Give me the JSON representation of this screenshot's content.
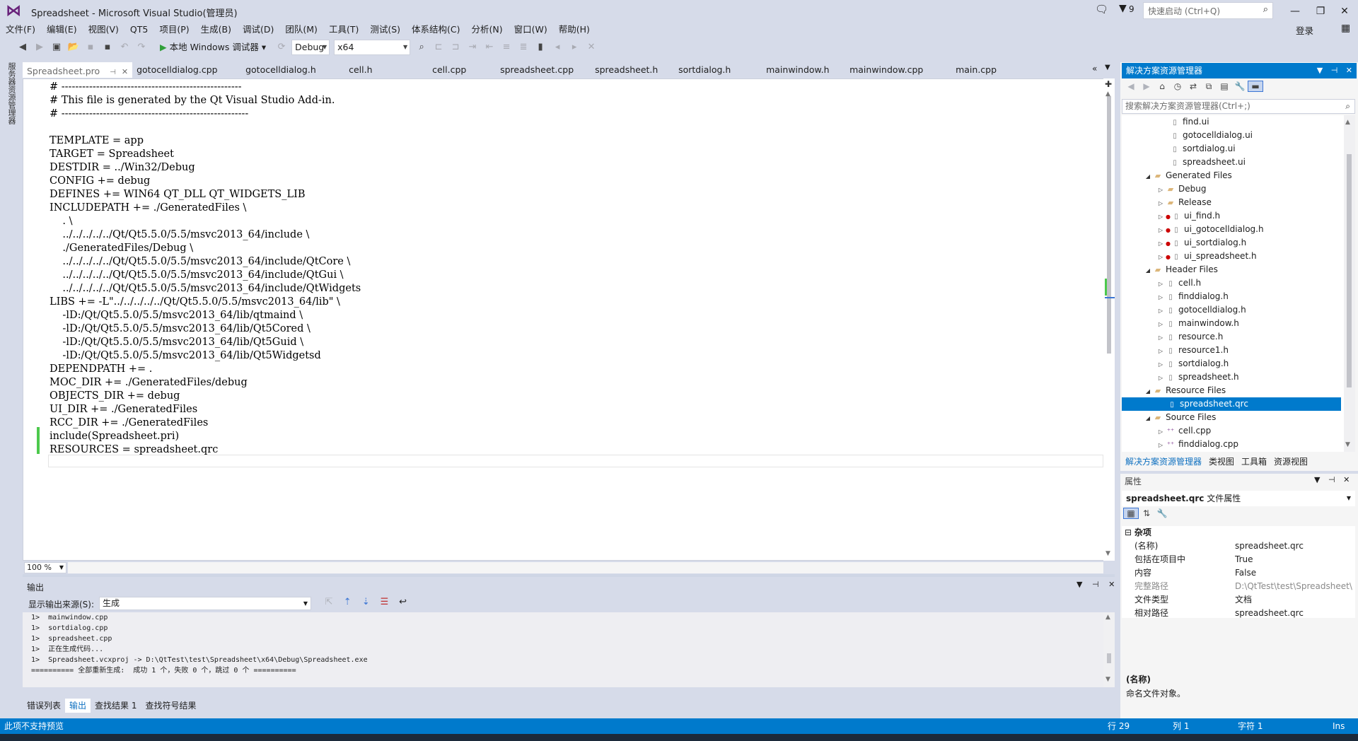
{
  "window": {
    "title": "Spreadsheet - Microsoft Visual Studio(管理员)",
    "notification_count": "9",
    "quick_launch_placeholder": "快速启动 (Ctrl+Q)",
    "login": "登录"
  },
  "menu": [
    "文件(F)",
    "编辑(E)",
    "视图(V)",
    "QT5",
    "项目(P)",
    "生成(B)",
    "调试(D)",
    "团队(M)",
    "工具(T)",
    "测试(S)",
    "体系结构(C)",
    "分析(N)",
    "窗口(W)",
    "帮助(H)"
  ],
  "toolbar": {
    "start_label": "本地 Windows 调试器",
    "config": "Debug",
    "platform": "x64"
  },
  "left_strip_label": "服务器资源管理器",
  "tabs": {
    "active": "Spreadsheet.pro",
    "others": [
      "gotocelldialog.cpp",
      "gotocelldialog.h",
      "cell.h",
      "cell.cpp",
      "spreadsheet.cpp",
      "spreadsheet.h",
      "sortdialog.h",
      "mainwindow.h",
      "mainwindow.cpp",
      "main.cpp"
    ]
  },
  "editor": {
    "code": "# ----------------------------------------------------\n# This file is generated by the Qt Visual Studio Add-in.\n# ------------------------------------------------------\n\nTEMPLATE = app\nTARGET = Spreadsheet\nDESTDIR = ../Win32/Debug\nCONFIG += debug\nDEFINES += WIN64 QT_DLL QT_WIDGETS_LIB\nINCLUDEPATH += ./GeneratedFiles \\\n    . \\\n    ../../../../../Qt/Qt5.5.0/5.5/msvc2013_64/include \\\n    ./GeneratedFiles/Debug \\\n    ../../../../../Qt/Qt5.5.0/5.5/msvc2013_64/include/QtCore \\\n    ../../../../../Qt/Qt5.5.0/5.5/msvc2013_64/include/QtGui \\\n    ../../../../../Qt/Qt5.5.0/5.5/msvc2013_64/include/QtWidgets\nLIBS += -L\"../../../../../Qt/Qt5.5.0/5.5/msvc2013_64/lib\" \\\n    -lD:/Qt/Qt5.5.0/5.5/msvc2013_64/lib/qtmaind \\\n    -lD:/Qt/Qt5.5.0/5.5/msvc2013_64/lib/Qt5Cored \\\n    -lD:/Qt/Qt5.5.0/5.5/msvc2013_64/lib/Qt5Guid \\\n    -lD:/Qt/Qt5.5.0/5.5/msvc2013_64/lib/Qt5Widgetsd\nDEPENDPATH += .\nMOC_DIR += ./GeneratedFiles/debug\nOBJECTS_DIR += debug\nUI_DIR += ./GeneratedFiles\nRCC_DIR += ./GeneratedFiles\ninclude(Spreadsheet.pri)\nRESOURCES = spreadsheet.qrc",
    "zoom": "100 %"
  },
  "output": {
    "title": "输出",
    "source_label": "显示输出来源(S):",
    "source_value": "生成",
    "text": "1>  mainwindow.cpp\n1>  sortdialog.cpp\n1>  spreadsheet.cpp\n1>  正在生成代码...\n1>  Spreadsheet.vcxproj -> D:\\QtTest\\test\\Spreadsheet\\x64\\Debug\\Spreadsheet.exe\n========== 全部重新生成:  成功 1 个，失败 0 个，跳过 0 个 =========="
  },
  "bottom_tabs": [
    "错误列表",
    "输出",
    "查找结果 1",
    "查找符号结果"
  ],
  "solution_explorer": {
    "title": "解决方案资源管理器",
    "search_placeholder": "搜索解决方案资源管理器(Ctrl+;)",
    "tree": [
      {
        "label": "find.ui",
        "kind": "file"
      },
      {
        "label": "gotocelldialog.ui",
        "kind": "file"
      },
      {
        "label": "sortdialog.ui",
        "kind": "file"
      },
      {
        "label": "spreadsheet.ui",
        "kind": "file"
      },
      {
        "label": "Generated Files",
        "kind": "folder-open"
      },
      {
        "label": "Debug",
        "kind": "folder"
      },
      {
        "label": "Release",
        "kind": "folder"
      },
      {
        "label": "ui_find.h",
        "kind": "file-dot"
      },
      {
        "label": "ui_gotocelldialog.h",
        "kind": "file-dot"
      },
      {
        "label": "ui_sortdialog.h",
        "kind": "file-dot"
      },
      {
        "label": "ui_spreadsheet.h",
        "kind": "file-dot"
      },
      {
        "label": "Header Files",
        "kind": "folder-open"
      },
      {
        "label": "cell.h",
        "kind": "file-arrow"
      },
      {
        "label": "finddialog.h",
        "kind": "file-arrow"
      },
      {
        "label": "gotocelldialog.h",
        "kind": "file-arrow"
      },
      {
        "label": "mainwindow.h",
        "kind": "file-arrow"
      },
      {
        "label": "resource.h",
        "kind": "file-arrow"
      },
      {
        "label": "resource1.h",
        "kind": "file-arrow"
      },
      {
        "label": "sortdialog.h",
        "kind": "file-arrow"
      },
      {
        "label": "spreadsheet.h",
        "kind": "file-arrow"
      },
      {
        "label": "Resource Files",
        "kind": "folder-open"
      },
      {
        "label": "spreadsheet.qrc",
        "kind": "file-selected"
      },
      {
        "label": "Source Files",
        "kind": "folder-open"
      },
      {
        "label": "cell.cpp",
        "kind": "cpp"
      },
      {
        "label": "finddialog.cpp",
        "kind": "cpp"
      }
    ],
    "tabs": [
      "解决方案资源管理器",
      "类视图",
      "工具箱",
      "资源视图"
    ]
  },
  "properties": {
    "title": "属性",
    "object_name": "spreadsheet.qrc",
    "object_type": "文件属性",
    "category": "杂项",
    "rows": [
      {
        "name": "(名称)",
        "value": "spreadsheet.qrc",
        "dim": false
      },
      {
        "name": "包括在项目中",
        "value": "True",
        "dim": false
      },
      {
        "name": "内容",
        "value": "False",
        "dim": false
      },
      {
        "name": "完整路径",
        "value": "D:\\QtTest\\test\\Spreadsheet\\",
        "dim": true
      },
      {
        "name": "文件类型",
        "value": "文档",
        "dim": false
      },
      {
        "name": "相对路径",
        "value": "spreadsheet.qrc",
        "dim": false
      }
    ],
    "desc_title": "(名称)",
    "desc_text": "命名文件对象。"
  },
  "status": {
    "message": "此项不支持预览",
    "line": "行 29",
    "col": "列 1",
    "char": "字符 1",
    "mode": "Ins"
  },
  "colors": {
    "accent": "#007acc",
    "logo": "#68217a",
    "change_bar": "#4cc94c"
  }
}
